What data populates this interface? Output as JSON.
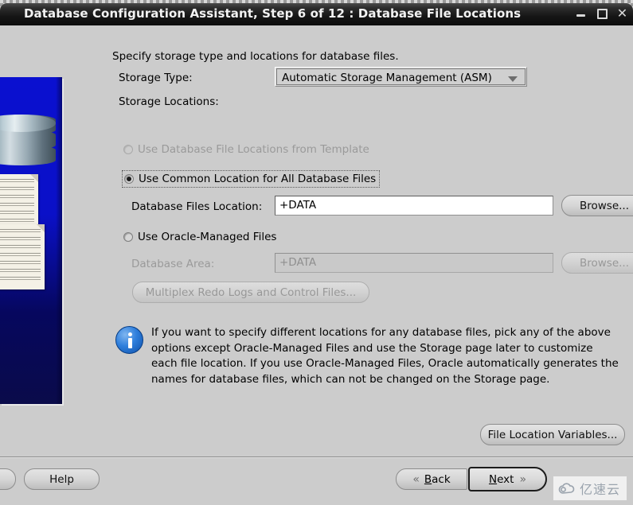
{
  "window": {
    "title": "Database Configuration Assistant, Step 6 of 12 : Database File Locations",
    "minimize_label": "–",
    "maximize_label": "",
    "close_label": "✕",
    "minimize_icon": "minimize-icon",
    "maximize_icon": "maximize-icon",
    "close_icon": "close-icon"
  },
  "content": {
    "intro": "Specify storage type and locations for database files.",
    "storage_type_label": "Storage Type:",
    "storage_type_value": "Automatic Storage Management (ASM)",
    "storage_locations_label": "Storage Locations:",
    "option_template": "Use Database File Locations from Template",
    "option_common": "Use Common Location for All Database Files",
    "option_omf": "Use Oracle-Managed Files",
    "database_files_location_label": "Database Files Location:",
    "database_files_location_value": "+DATA",
    "database_area_label": "Database Area:",
    "database_area_value": "+DATA",
    "browse_label": "Browse...",
    "multiplex_label": "Multiplex Redo Logs and Control Files...",
    "info_text": "If you want to specify different locations for any database files, pick any of the above options except Oracle-Managed Files and use the Storage page later to customize each file location. If you use Oracle-Managed Files, Oracle automatically generates the names for database files, which can not be changed on the Storage page.",
    "file_location_variables_label": "File Location Variables..."
  },
  "footer": {
    "help_label": "Help",
    "back_label_pre": "B",
    "back_label_post": "ack",
    "next_label_pre": "N",
    "next_label_post": "ext",
    "back_chevron": "«",
    "next_chevron": "»"
  },
  "watermark": {
    "text": "亿速云",
    "icon": "cloud-icon"
  },
  "colors": {
    "titlebar": "#151515",
    "dialog_bg": "#cccccc",
    "banner_blue": "#0a10c8",
    "info_blue": "#2f7fdc",
    "field_white": "#ffffff",
    "disabled_text": "#9a9a9a"
  }
}
